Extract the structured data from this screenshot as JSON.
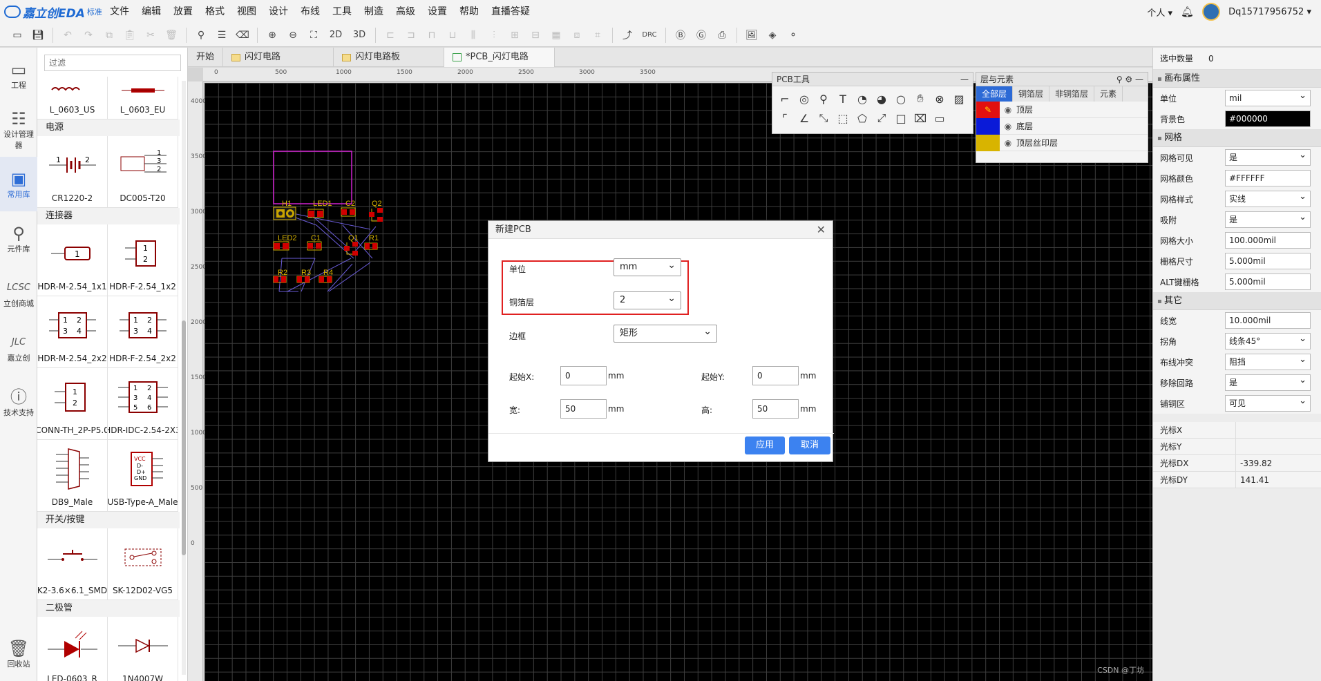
{
  "app": {
    "logo_text": "嘉立创EDA",
    "edition": "标准"
  },
  "menu": [
    "文件",
    "编辑",
    "放置",
    "格式",
    "视图",
    "设计",
    "布线",
    "工具",
    "制造",
    "高级",
    "设置",
    "帮助",
    "直播答疑"
  ],
  "user": {
    "personal": "个人",
    "username": "Dq15717956752"
  },
  "toolbar": {
    "view_2d": "2D",
    "view_3d": "3D",
    "drc": "DRC"
  },
  "leftnav": [
    {
      "label": "工程",
      "icon": "folder-icon"
    },
    {
      "label": "设计管理器",
      "icon": "tree-icon"
    },
    {
      "label": "常用库",
      "icon": "chip-icon"
    },
    {
      "label": "元件库",
      "icon": "magnifier-icon"
    },
    {
      "label": "立创商城",
      "icon": "lcsc-icon"
    },
    {
      "label": "嘉立创",
      "icon": "jlc-icon"
    },
    {
      "label": "技术支持",
      "icon": "help-icon"
    },
    {
      "label": "回收站",
      "icon": "trash-icon"
    }
  ],
  "library": {
    "filter_placeholder": "过滤",
    "top_items": [
      "L_0603_US",
      "L_0603_EU"
    ],
    "sections": [
      {
        "title": "电源",
        "items": [
          "CR1220-2",
          "DC005-T20"
        ]
      },
      {
        "title": "连接器",
        "items": [
          "HDR-M-2.54_1x1",
          "HDR-F-2.54_1x2",
          "HDR-M-2.54_2x2",
          "HDR-F-2.54_2x2",
          "CONN-TH_2P-P5.0",
          "HDR-IDC-2.54-2X3",
          "DB9_Male",
          "USB-Type-A_Male"
        ]
      },
      {
        "title": "开关/按键",
        "items": [
          "K2-3.6×6.1_SMD",
          "SK-12D02-VG5"
        ]
      },
      {
        "title": "二极管",
        "items": [
          "LED-0603_R",
          "1N4007W"
        ]
      }
    ]
  },
  "tabs": [
    "开始",
    "闪灯电路",
    "闪灯电路板",
    "*PCB_闪灯电路"
  ],
  "ruler": {
    "h": [
      "0",
      "500",
      "1000",
      "1500",
      "2000",
      "2500",
      "3000",
      "3500"
    ],
    "v": [
      "4000",
      "3500",
      "3000",
      "2500",
      "2000",
      "1500",
      "1000",
      "500",
      "0"
    ]
  },
  "pcb_labels": [
    "H1",
    "LED1",
    "C2",
    "Q2",
    "LED2",
    "C1",
    "Q1",
    "R1",
    "R2",
    "R3",
    "R4"
  ],
  "pcb_tools": {
    "title": "PCB工具"
  },
  "layers": {
    "title": "层与元素",
    "tabs": [
      "全部层",
      "铜箔层",
      "非铜箔层",
      "元素"
    ],
    "rows": [
      {
        "name": "顶层",
        "color": "#e11010"
      },
      {
        "name": "底层",
        "color": "#0a1ad8"
      },
      {
        "name": "顶层丝印层",
        "color": "#d8b400"
      }
    ]
  },
  "right_panel": {
    "selected_label": "选中数量",
    "selected_count": "0",
    "canvas_section": "画布属性",
    "canvas_props": [
      {
        "label": "单位",
        "value": "mil",
        "type": "select"
      },
      {
        "label": "背景色",
        "value": "#000000",
        "type": "color"
      }
    ],
    "grid_section": "网格",
    "grid_props": [
      {
        "label": "网格可见",
        "value": "是",
        "type": "select"
      },
      {
        "label": "网格颜色",
        "value": "#FFFFFF",
        "type": "input"
      },
      {
        "label": "网格样式",
        "value": "实线",
        "type": "select"
      },
      {
        "label": "吸附",
        "value": "是",
        "type": "select"
      },
      {
        "label": "网格大小",
        "value": "100.000mil",
        "type": "input"
      },
      {
        "label": "栅格尺寸",
        "value": "5.000mil",
        "type": "input"
      },
      {
        "label": "ALT键栅格",
        "value": "5.000mil",
        "type": "input"
      }
    ],
    "other_section": "其它",
    "other_props": [
      {
        "label": "线宽",
        "value": "10.000mil",
        "type": "input"
      },
      {
        "label": "拐角",
        "value": "线条45°",
        "type": "select"
      },
      {
        "label": "布线冲突",
        "value": "阻挡",
        "type": "select"
      },
      {
        "label": "移除回路",
        "value": "是",
        "type": "select"
      },
      {
        "label": "铺铜区",
        "value": "可见",
        "type": "select"
      }
    ],
    "cursor": [
      {
        "label": "光标X",
        "value": ""
      },
      {
        "label": "光标Y",
        "value": ""
      },
      {
        "label": "光标DX",
        "value": "-339.82"
      },
      {
        "label": "光标DY",
        "value": "141.41"
      }
    ]
  },
  "dialog": {
    "title": "新建PCB",
    "unit_label": "单位",
    "unit_value": "mm",
    "copper_label": "铜箔层",
    "copper_value": "2",
    "border_label": "边框",
    "border_value": "矩形",
    "startx_label": "起始X:",
    "startx_value": "0",
    "starty_label": "起始Y:",
    "starty_value": "0",
    "width_label": "宽:",
    "width_value": "50",
    "height_label": "高:",
    "height_value": "50",
    "mm": "mm",
    "apply": "应用",
    "cancel": "取消"
  },
  "watermark": "CSDN @丁坊"
}
